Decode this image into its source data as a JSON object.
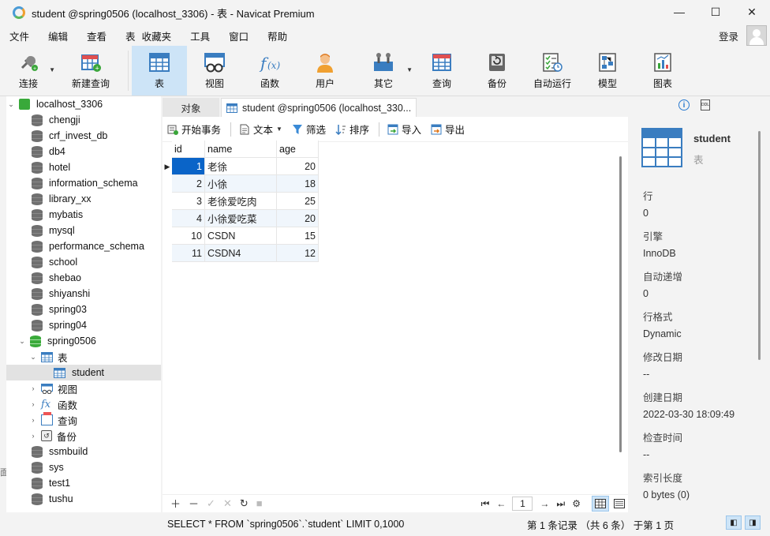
{
  "window": {
    "title": "student @spring0506 (localhost_3306) - 表 - Navicat Premium",
    "minimize": "—",
    "maximize": "☐",
    "close": "✕"
  },
  "menu": [
    "文件",
    "编辑",
    "查看",
    "表",
    "收藏夹",
    "工具",
    "窗口",
    "帮助"
  ],
  "login_label": "登录",
  "toolbar": [
    {
      "label": "连接",
      "icon": "plug-icon",
      "dropdown": true
    },
    {
      "label": "新建查询",
      "icon": "new-query-icon"
    },
    {
      "label": "表",
      "icon": "table-icon",
      "active": true
    },
    {
      "label": "视图",
      "icon": "view-icon"
    },
    {
      "label": "函数",
      "icon": "function-icon"
    },
    {
      "label": "用户",
      "icon": "user-icon"
    },
    {
      "label": "其它",
      "icon": "tools-icon",
      "dropdown": true
    },
    {
      "label": "查询",
      "icon": "query-icon"
    },
    {
      "label": "备份",
      "icon": "backup-icon"
    },
    {
      "label": "自动运行",
      "icon": "schedule-icon"
    },
    {
      "label": "模型",
      "icon": "model-icon"
    },
    {
      "label": "图表",
      "icon": "chart-icon"
    }
  ],
  "tree": {
    "connection": "localhost_3306",
    "databases_before": [
      "chengji",
      "crf_invest_db",
      "db4",
      "hotel",
      "information_schema",
      "library_xx",
      "mybatis",
      "mysql",
      "performance_schema",
      "school",
      "shebao",
      "shiyanshi",
      "spring03",
      "spring04"
    ],
    "open_db": "spring0506",
    "tables_node": "表",
    "selected_table": "student",
    "other_nodes": [
      "视图",
      "函数",
      "查询",
      "备份"
    ],
    "databases_after": [
      "ssmbuild",
      "sys",
      "test1",
      "tushu"
    ]
  },
  "tabs": {
    "objects": "对象",
    "active": "student @spring0506 (localhost_330..."
  },
  "subtoolbar": {
    "begin_tx": "开始事务",
    "text": "文本",
    "filter": "筛选",
    "sort": "排序",
    "import": "导入",
    "export": "导出"
  },
  "grid": {
    "columns": [
      "id",
      "name",
      "age"
    ],
    "rows": [
      [
        "1",
        "老徐",
        "20"
      ],
      [
        "2",
        "小徐",
        "18"
      ],
      [
        "3",
        "老徐爱吃肉",
        "25"
      ],
      [
        "4",
        "小徐爱吃菜",
        "20"
      ],
      [
        "10",
        "CSDN",
        "15"
      ],
      [
        "11",
        "CSDN4",
        "12"
      ]
    ]
  },
  "pager": {
    "page": "1"
  },
  "status": {
    "sql": "SELECT * FROM `spring0506`.`student` LIMIT 0,1000",
    "records": "第 1 条记录 （共 6 条） 于第 1 页"
  },
  "info_panel": {
    "name": "student",
    "type": "表",
    "properties": [
      {
        "key": "行",
        "value": "0"
      },
      {
        "key": "引擎",
        "value": "InnoDB"
      },
      {
        "key": "自动递增",
        "value": "0"
      },
      {
        "key": "行格式",
        "value": "Dynamic"
      },
      {
        "key": "修改日期",
        "value": "--"
      },
      {
        "key": "创建日期",
        "value": "2022-03-30 18:09:49"
      },
      {
        "key": "检查时间",
        "value": "--"
      },
      {
        "key": "索引长度",
        "value": "0 bytes (0)"
      }
    ]
  },
  "left_edge_text": "面",
  "colors": {
    "accent": "#3a7dc0",
    "selection": "#0a64c8",
    "active_tool": "#cde4f7"
  }
}
